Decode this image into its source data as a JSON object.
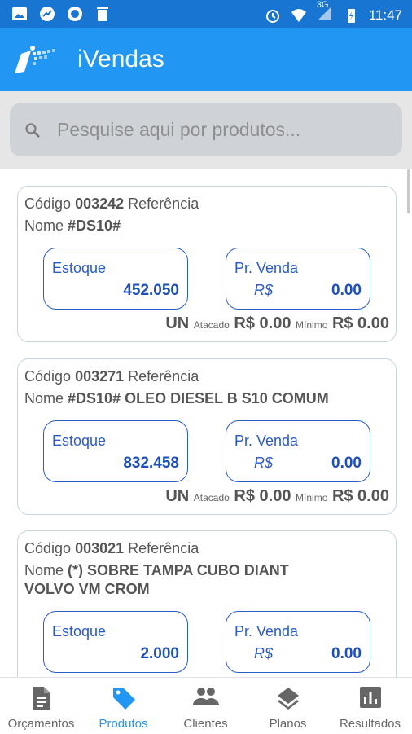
{
  "status_bar": {
    "time": "11:47",
    "network": "3G"
  },
  "app": {
    "title": "iVendas"
  },
  "search": {
    "placeholder": "Pesquise aqui por produtos..."
  },
  "products": [
    {
      "codigo_label": "Código",
      "codigo": "003242",
      "referencia_label": "Referência",
      "nome_label": "Nome",
      "nome": "#DS10#",
      "nome_line2": "",
      "estoque_label": "Estoque",
      "estoque": "452.050",
      "prvenda_label": "Pr. Venda",
      "currency": "R$",
      "prvenda": "0.00",
      "unit": "UN",
      "atacado_label": "Atacado",
      "atacado": "R$ 0.00",
      "minimo_label": "Mínimo",
      "minimo": "R$ 0.00"
    },
    {
      "codigo_label": "Código",
      "codigo": "003271",
      "referencia_label": "Referência",
      "nome_label": "Nome",
      "nome": "#DS10# OLEO DIESEL B S10 COMUM",
      "nome_line2": "",
      "estoque_label": "Estoque",
      "estoque": "832.458",
      "prvenda_label": "Pr. Venda",
      "currency": "R$",
      "prvenda": "0.00",
      "unit": "UN",
      "atacado_label": "Atacado",
      "atacado": "R$ 0.00",
      "minimo_label": "Mínimo",
      "minimo": "R$ 0.00"
    },
    {
      "codigo_label": "Código",
      "codigo": "003021",
      "referencia_label": "Referência",
      "nome_label": "Nome",
      "nome": "(*) SOBRE TAMPA CUBO DIANT",
      "nome_line2": "VOLVO VM CROM",
      "estoque_label": "Estoque",
      "estoque": "2.000",
      "prvenda_label": "Pr. Venda",
      "currency": "R$",
      "prvenda": "0.00"
    }
  ],
  "nav": [
    {
      "label": "Orçamentos",
      "icon": "document-icon",
      "active": false
    },
    {
      "label": "Produtos",
      "icon": "tag-icon",
      "active": true
    },
    {
      "label": "Clientes",
      "icon": "people-icon",
      "active": false
    },
    {
      "label": "Planos",
      "icon": "layers-icon",
      "active": false
    },
    {
      "label": "Resultados",
      "icon": "bar-chart-icon",
      "active": false
    }
  ],
  "colors": {
    "primary": "#2196F3",
    "status_bar": "#1876D2",
    "accent_blue": "#2A5BC7"
  }
}
